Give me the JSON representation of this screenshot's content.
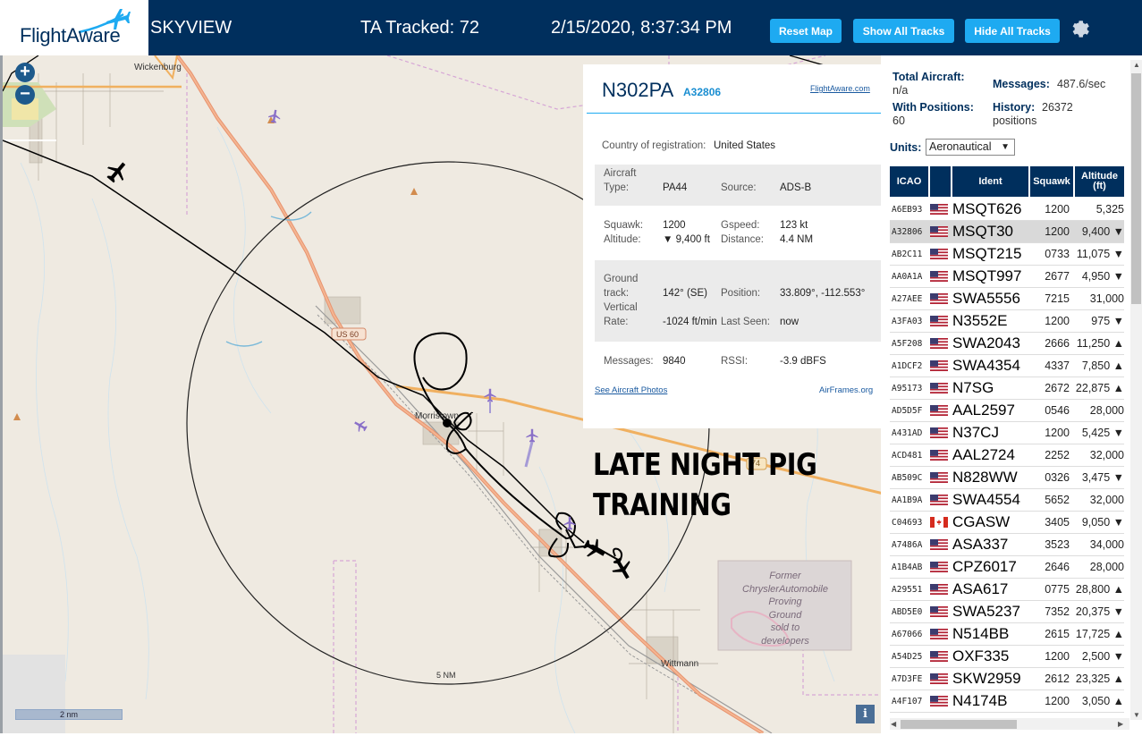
{
  "header": {
    "logo": "FlightAware",
    "app_title": "SKYVIEW",
    "tracked": "TA Tracked: 72",
    "datetime": "2/15/2020, 8:37:34 PM",
    "reset_map": "Reset Map",
    "show_all_tracks": "Show All Tracks",
    "hide_all_tracks": "Hide All Tracks",
    "settings_icon": "gear-icon",
    "colors": {
      "bar": "#002f5d",
      "button": "#1eaaf1"
    }
  },
  "map": {
    "zoom_in": "+",
    "zoom_out": "−",
    "labels": {
      "wickenburg": "Wickenburg",
      "morristown": "Morristown",
      "wittmann": "Wittmann",
      "us60": "US 60",
      "range_ring": "5 NM",
      "hwy74": "74"
    },
    "scale": "2 nm",
    "info": "i",
    "annotation": [
      "LATE NIGHT PIG",
      "TRAINING"
    ],
    "proving_ground_text": [
      "Former",
      "ChryslerAutomobile",
      "Proving",
      "Ground",
      "sold to",
      "developers"
    ]
  },
  "selected": {
    "ident": "N302PA",
    "icao": "A32806",
    "flightaware_link": "FlightAware.com",
    "country_label": "Country of registration:",
    "country": "United States",
    "aircraft_type_label_1": "Aircraft",
    "aircraft_type_label_2": "Type:",
    "aircraft_type": "PA44",
    "source_label": "Source:",
    "source": "ADS-B",
    "squawk_label": "Squawk:",
    "squawk": "1200",
    "gspeed_label": "Gspeed:",
    "gspeed": "123 kt",
    "altitude_label": "Altitude:",
    "altitude": "▼ 9,400 ft",
    "distance_label": "Distance:",
    "distance": "4.4 NM",
    "ground_label_1": "Ground",
    "ground_label_2": "track:",
    "ground_track": "142° (SE)",
    "position_label": "Position:",
    "position": "33.809°, -112.553°",
    "vrate_label_1": "Vertical",
    "vrate_label_2": "Rate:",
    "vertical_rate": "-1024 ft/min",
    "last_seen_label": "Last Seen:",
    "last_seen": "now",
    "messages_label": "Messages:",
    "messages": "9840",
    "rssi_label": "RSSI:",
    "rssi": "-3.9 dBFS",
    "photos_link": "See Aircraft Photos",
    "airframes_link": "AirFrames.org"
  },
  "stats": {
    "total_label": "Total Aircraft:",
    "total": "n/a",
    "messages_label": "Messages:",
    "messages": "487.6/sec",
    "with_pos_label": "With Positions:",
    "with_pos": "60",
    "history_label": "History:",
    "history_1": "26372",
    "history_2": "positions",
    "units_label": "Units:",
    "units": "Aeronautical"
  },
  "table": {
    "headers": {
      "icao": "ICAO",
      "ident": "Ident",
      "squawk": "Squawk",
      "altitude_1": "Altitude",
      "altitude_2": "(ft)"
    },
    "rows": [
      {
        "icao": "A6EB93",
        "flag": "us",
        "ident": "MSQT626",
        "squawk": "1200",
        "alt": "5,325"
      },
      {
        "icao": "A32806",
        "flag": "us",
        "ident": "MSQT30",
        "squawk": "1200",
        "alt": "9,400 ▼",
        "selected": true
      },
      {
        "icao": "AB2C11",
        "flag": "us",
        "ident": "MSQT215",
        "squawk": "0733",
        "alt": "11,075 ▼"
      },
      {
        "icao": "AA0A1A",
        "flag": "us",
        "ident": "MSQT997",
        "squawk": "2677",
        "alt": "4,950 ▼"
      },
      {
        "icao": "A27AEE",
        "flag": "us",
        "ident": "SWA5556",
        "squawk": "7215",
        "alt": "31,000"
      },
      {
        "icao": "A3FA03",
        "flag": "us",
        "ident": "N3552E",
        "squawk": "1200",
        "alt": "975 ▼"
      },
      {
        "icao": "A5F208",
        "flag": "us",
        "ident": "SWA2043",
        "squawk": "2666",
        "alt": "11,250 ▲"
      },
      {
        "icao": "A1DCF2",
        "flag": "us",
        "ident": "SWA4354",
        "squawk": "4337",
        "alt": "7,850 ▲"
      },
      {
        "icao": "A95173",
        "flag": "us",
        "ident": "N7SG",
        "squawk": "2672",
        "alt": "22,875 ▲"
      },
      {
        "icao": "AD5D5F",
        "flag": "us",
        "ident": "AAL2597",
        "squawk": "0546",
        "alt": "28,000"
      },
      {
        "icao": "A431AD",
        "flag": "us",
        "ident": "N37CJ",
        "squawk": "1200",
        "alt": "5,425 ▼"
      },
      {
        "icao": "ACD481",
        "flag": "us",
        "ident": "AAL2724",
        "squawk": "2252",
        "alt": "32,000"
      },
      {
        "icao": "AB509C",
        "flag": "us",
        "ident": "N828WW",
        "squawk": "0326",
        "alt": "3,475 ▼"
      },
      {
        "icao": "AA1B9A",
        "flag": "us",
        "ident": "SWA4554",
        "squawk": "5652",
        "alt": "32,000"
      },
      {
        "icao": "C04693",
        "flag": "ca",
        "ident": "CGASW",
        "squawk": "3405",
        "alt": "9,050 ▼"
      },
      {
        "icao": "A7486A",
        "flag": "us",
        "ident": "ASA337",
        "squawk": "3523",
        "alt": "34,000"
      },
      {
        "icao": "A1B4AB",
        "flag": "us",
        "ident": "CPZ6017",
        "squawk": "2646",
        "alt": "28,000"
      },
      {
        "icao": "A29551",
        "flag": "us",
        "ident": "ASA617",
        "squawk": "0775",
        "alt": "28,800 ▲"
      },
      {
        "icao": "ABD5E0",
        "flag": "us",
        "ident": "SWA5237",
        "squawk": "7352",
        "alt": "20,375 ▼"
      },
      {
        "icao": "A67066",
        "flag": "us",
        "ident": "N514BB",
        "squawk": "2615",
        "alt": "17,725 ▲"
      },
      {
        "icao": "A54D25",
        "flag": "us",
        "ident": "OXF335",
        "squawk": "1200",
        "alt": "2,500 ▼"
      },
      {
        "icao": "A7D3FE",
        "flag": "us",
        "ident": "SKW2959",
        "squawk": "2612",
        "alt": "23,325 ▲"
      },
      {
        "icao": "A4F107",
        "flag": "us",
        "ident": "N4174B",
        "squawk": "1200",
        "alt": "3,050 ▲"
      }
    ]
  }
}
